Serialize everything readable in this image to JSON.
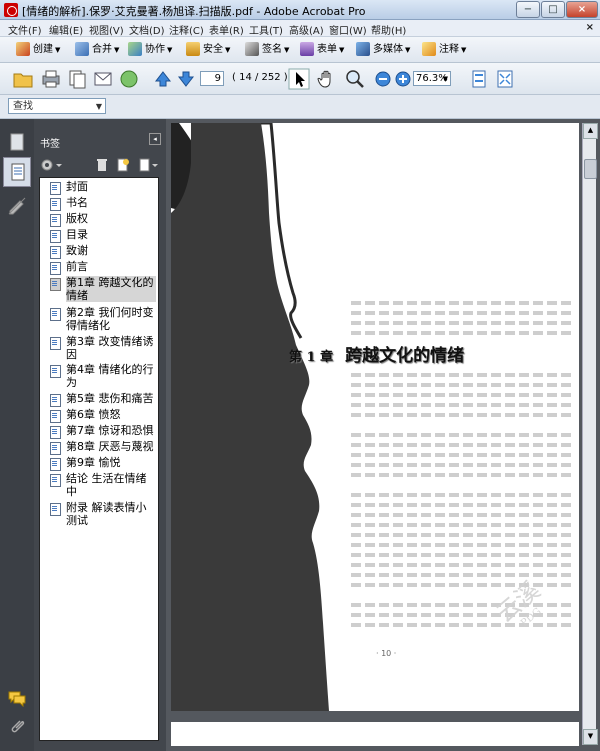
{
  "window": {
    "title": "[情绪的解析].保罗·艾克曼著.杨旭译.扫描版.pdf - Adobe Acrobat Pro",
    "minimize_label": "−",
    "maximize_label": "□",
    "close_label": "×"
  },
  "menu": {
    "items": [
      "文件(F)",
      "编辑(E)",
      "视图(V)",
      "文档(D)",
      "注释(C)",
      "表单(R)",
      "工具(T)",
      "高级(A)",
      "窗口(W)",
      "帮助(H)"
    ],
    "close_label": "×"
  },
  "toolbar1": {
    "create": "创建",
    "combine": "合并",
    "collaborate": "协作",
    "secure": "安全",
    "sign": "签名",
    "forms": "表单",
    "multimedia": "多媒体",
    "comment": "注释"
  },
  "toolbar2": {
    "page_current": "9",
    "page_count": "( 14 / 252 )",
    "zoom": "76.3%"
  },
  "find": {
    "placeholder": "查找"
  },
  "bookmarks": {
    "title": "书签",
    "items": [
      {
        "label": "封面"
      },
      {
        "label": "书名"
      },
      {
        "label": "版权"
      },
      {
        "label": "目录"
      },
      {
        "label": "致谢"
      },
      {
        "label": "前言"
      },
      {
        "label": "第1章 跨越文化的情绪"
      },
      {
        "label": "第2章 我们何时变得情绪化"
      },
      {
        "label": "第3章 改变情绪诱因"
      },
      {
        "label": "第4章 情绪化的行为"
      },
      {
        "label": "第5章 悲伤和痛苦"
      },
      {
        "label": "第6章 愤怒"
      },
      {
        "label": "第7章 惊讶和恐惧"
      },
      {
        "label": "第8章 厌恶与蔑视"
      },
      {
        "label": "第9章 愉悦"
      },
      {
        "label": "结论 生活在情绪中"
      },
      {
        "label": "附录 解读表情小测试"
      }
    ]
  },
  "document": {
    "chapter_number": "第 1 章",
    "chapter_title": "跨越文化的情绪",
    "page_number": "· 10 ·",
    "watermark": "云溪",
    "watermark_sub": "PDG"
  },
  "colors": {
    "accent": "#2b6cc4",
    "sidebar_dark": "#42464c",
    "doc_background": "#54585e"
  }
}
